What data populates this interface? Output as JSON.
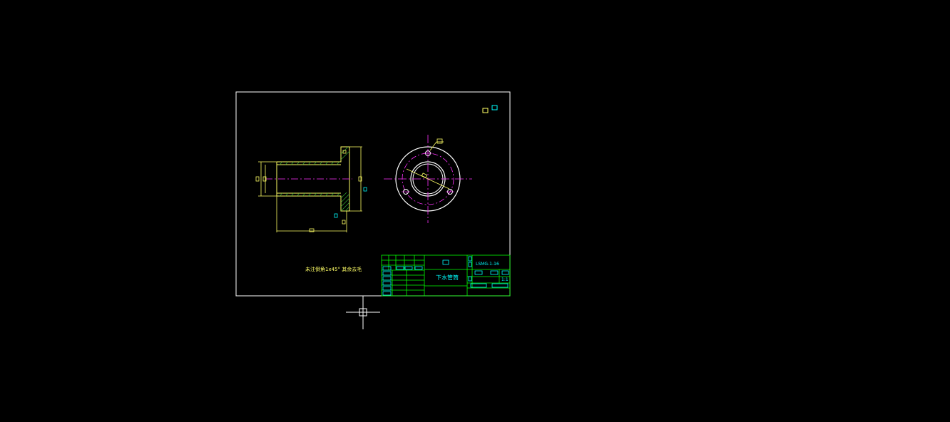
{
  "drawing": {
    "note_text": "未注倒角1x45° 其余去毛",
    "part_name": "下水管筒",
    "drawing_number": "LSMG-1-16",
    "scale": "1:1"
  },
  "colors": {
    "background": "#000000",
    "frame": "#ffffff",
    "part_outline": "#ffff66",
    "centerline": "#ff33ff",
    "title_block": "#00ff00",
    "annotation": "#00ffff",
    "hatch": "#33aa33",
    "cursor": "#ffffff"
  },
  "icons": {
    "cursor": "crosshair-cursor-icon"
  }
}
